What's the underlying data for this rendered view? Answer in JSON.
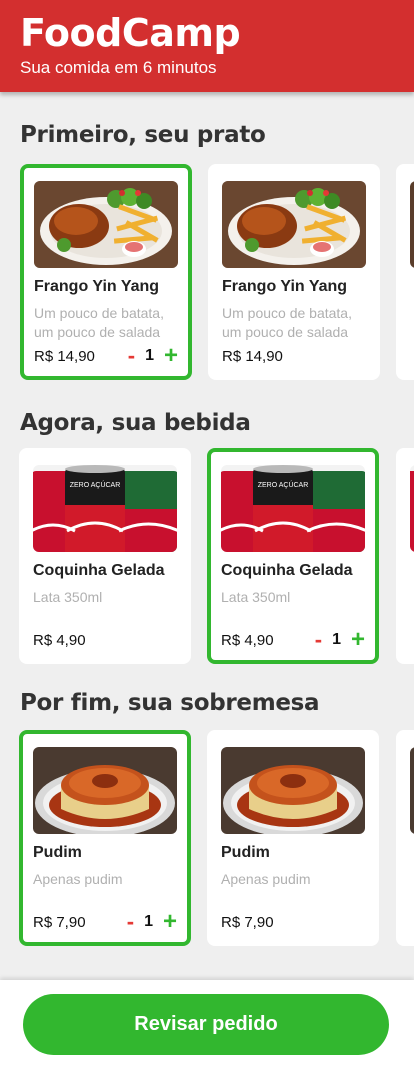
{
  "header": {
    "brand": "FoodCamp",
    "tagline": "Sua comida em 6 minutos"
  },
  "sections": [
    {
      "title": "Primeiro, seu prato",
      "items": [
        {
          "name": "Frango Yin Yang",
          "desc": "Um pouco de batata, um pouco de salada",
          "price": "R$ 14,90",
          "selected": true,
          "qty": "1",
          "image": "chicken-plate"
        },
        {
          "name": "Frango Yin Yang",
          "desc": "Um pouco de batata, um pouco de salada",
          "price": "R$ 14,90",
          "selected": false,
          "image": "chicken-plate"
        }
      ]
    },
    {
      "title": "Agora, sua bebida",
      "items": [
        {
          "name": "Coquinha Gelada",
          "desc": "Lata 350ml",
          "price": "R$ 4,90",
          "selected": false,
          "image": "coke-cans"
        },
        {
          "name": "Coquinha Gelada",
          "desc": "Lata 350ml",
          "price": "R$ 4,90",
          "selected": true,
          "qty": "1",
          "image": "coke-cans"
        }
      ]
    },
    {
      "title": "Por fim, sua sobremesa",
      "items": [
        {
          "name": "Pudim",
          "desc": "Apenas pudim",
          "price": "R$ 7,90",
          "selected": true,
          "qty": "1",
          "image": "pudding"
        },
        {
          "name": "Pudim",
          "desc": "Apenas pudim",
          "price": "R$ 7,90",
          "selected": false,
          "image": "pudding"
        }
      ]
    }
  ],
  "qty_controls": {
    "minus": "-",
    "plus": "+"
  },
  "footer": {
    "button_label": "Revisar pedido"
  },
  "colors": {
    "brand_red": "#d32f2f",
    "accent_green": "#32b72f",
    "minus_red": "#e53935"
  }
}
